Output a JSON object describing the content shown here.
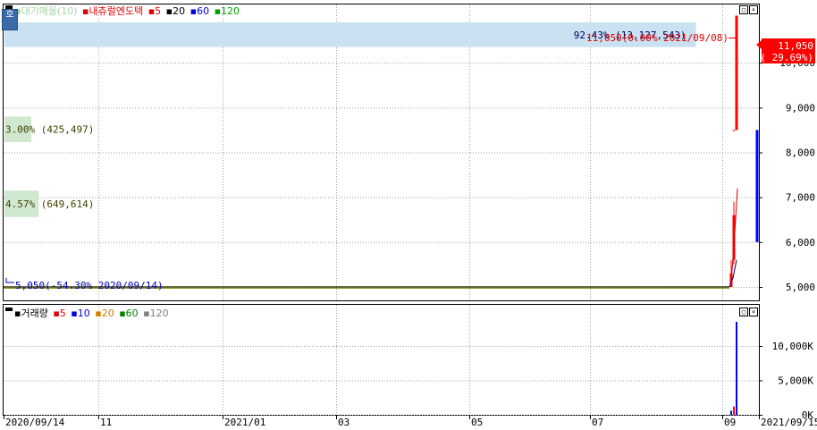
{
  "top_panel": {
    "legend": {
      "vol_profile": "▪대기매물(10)",
      "stock_name": "▪내츄럴엔도텍",
      "ma5": "▪5",
      "ma20": "▪20",
      "ma60": "▪60",
      "ma120": "▪120"
    },
    "left_button": "호"
  },
  "bottom_panel": {
    "legend": {
      "volume": "▪거래량",
      "ma5": "▪5",
      "ma10": "▪10",
      "ma20": "▪20",
      "ma60": "▪60",
      "ma120": "▪120"
    }
  },
  "chart_data": [
    {
      "type": "candlestick",
      "name": "price",
      "yticks": [
        "5,000",
        "6,000",
        "7,000",
        "8,000",
        "9,000",
        "10,000"
      ],
      "ylim": [
        4700,
        11300
      ],
      "current_price_label": "11,050",
      "current_change_label": "( 29.69%)",
      "high_annotation": "11,050(0.00% 2021/09/08)",
      "low_annotation": "5,050(-54.30% 2020/09/14)",
      "volume_profile": [
        {
          "label": "92.43% (13,127,543)",
          "price_low": 10350,
          "price_high": 10900,
          "pct": 92.43
        },
        {
          "label": "3.00% (425,497)",
          "price_low": 8230,
          "price_high": 8800,
          "pct": 3.0
        },
        {
          "label": "4.57% (649,614)",
          "price_low": 6560,
          "price_high": 7150,
          "pct": 4.57
        }
      ],
      "candles": [
        {
          "date": "2021/09/07",
          "open": 5000,
          "close": 5300,
          "low": 5000,
          "high": 5600,
          "color": "#ff0000"
        },
        {
          "date": "2021/09/08",
          "open": 5600,
          "close": 6600,
          "low": 5500,
          "high": 6900,
          "color": "#ff0000"
        },
        {
          "date": "2021/09/10",
          "open": 8500,
          "close": 8500,
          "low": 8500,
          "high": 8500,
          "color": "#ff0000"
        },
        {
          "date": "2021/09/14",
          "open": 8500,
          "close": 11050,
          "low": 9900,
          "high": 11050,
          "color": "#ff0000"
        },
        {
          "date": "2021/09/15",
          "open": 8500,
          "close": 6000,
          "low": 6000,
          "high": 8500,
          "color": "#0000ff"
        }
      ],
      "base_line": 5000
    },
    {
      "type": "bar",
      "name": "volume",
      "yticks": [
        "0K",
        "5,000K",
        "10,000K"
      ],
      "ylim": [
        0,
        14800
      ],
      "bars": [
        {
          "date": "2021/09/07",
          "value": 600,
          "color": "#0000ff"
        },
        {
          "date": "2021/09/08",
          "value": 1200,
          "color": "#ff0000"
        },
        {
          "date": "2021/09/14",
          "value": 13500,
          "color": "#0000ff"
        }
      ],
      "xticks": [
        "2020/09/14",
        "11",
        "2021/01",
        "03",
        "05",
        "07",
        "09",
        "2021/09/15"
      ]
    }
  ]
}
